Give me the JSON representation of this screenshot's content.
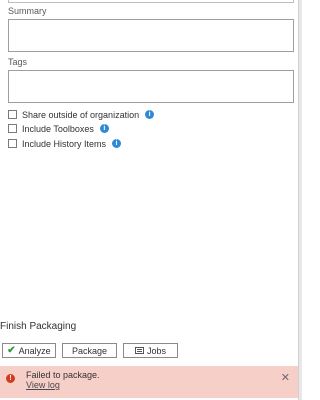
{
  "fields": {
    "summary": {
      "label": "Summary",
      "value": ""
    },
    "tags": {
      "label": "Tags",
      "value": ""
    }
  },
  "options": [
    {
      "id": "share",
      "label": "Share outside of organization",
      "checked": false,
      "icon": "info-icon"
    },
    {
      "id": "toolboxes",
      "label": "Include Toolboxes",
      "checked": false,
      "icon": "info-icon"
    },
    {
      "id": "history",
      "label": "Include History Items",
      "checked": false,
      "icon": "info-icon"
    }
  ],
  "finish": {
    "title": "Finish Packaging",
    "buttons": {
      "analyze": {
        "label": "Analyze",
        "icon": "checkmark-icon"
      },
      "package": {
        "label": "Package"
      },
      "jobs": {
        "label": "Jobs",
        "icon": "jobs-icon"
      }
    }
  },
  "alert": {
    "icon": "error-icon",
    "message": "Failed to package.",
    "link": "View log",
    "close_icon": "close-icon",
    "color": "#f7cfc9"
  },
  "colors": {
    "info": "#2f8ad6",
    "error": "#d23b1f",
    "success": "#2e9a3a"
  }
}
